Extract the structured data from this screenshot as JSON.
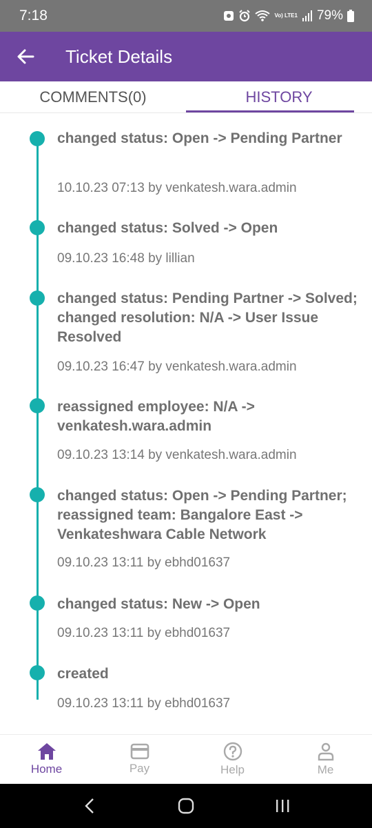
{
  "status_bar": {
    "time": "7:18",
    "network_label": "Vo) LTE1",
    "battery": "79%"
  },
  "header": {
    "title": "Ticket Details"
  },
  "tabs": [
    {
      "label": "COMMENTS(0)",
      "active": false
    },
    {
      "label": "HISTORY",
      "active": true
    }
  ],
  "history": [
    {
      "text": "changed status: Open -> Pending Partner",
      "meta": "10.10.23 07:13 by venkatesh.wara.admin"
    },
    {
      "text": "changed status: Solved -> Open",
      "meta": "09.10.23 16:48 by lillian"
    },
    {
      "text": "changed status: Pending Partner -> Solved; changed resolution: N/A -> User Issue Resolved",
      "meta": "09.10.23 16:47 by venkatesh.wara.admin"
    },
    {
      "text": "reassigned employee: N/A -> venkatesh.wara.admin",
      "meta": "09.10.23 13:14 by venkatesh.wara.admin"
    },
    {
      "text": "changed status: Open -> Pending Partner; reassigned team: Bangalore East -> Venkateshwara Cable Network",
      "meta": "09.10.23 13:11 by ebhd01637"
    },
    {
      "text": "changed status: New -> Open",
      "meta": "09.10.23 13:11 by ebhd01637"
    },
    {
      "text": "created",
      "meta": "09.10.23 13:11 by ebhd01637"
    }
  ],
  "bottom_nav": [
    {
      "label": "Home",
      "icon": "home-icon",
      "active": true
    },
    {
      "label": "Pay",
      "icon": "card-icon",
      "active": false
    },
    {
      "label": "Help",
      "icon": "help-icon",
      "active": false
    },
    {
      "label": "Me",
      "icon": "person-icon",
      "active": false
    }
  ],
  "colors": {
    "primary": "#6e46a0",
    "timeline": "#16b0ad",
    "status_bar": "#767676"
  }
}
